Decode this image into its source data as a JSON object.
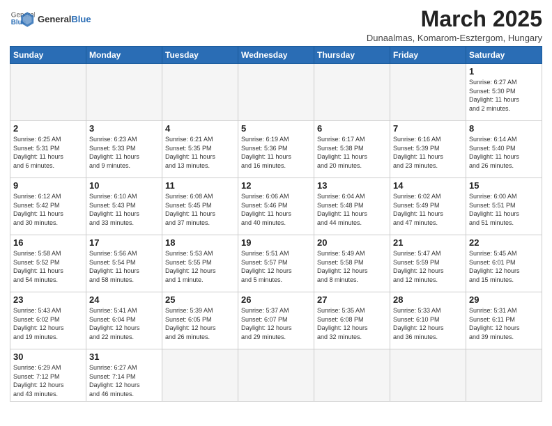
{
  "header": {
    "logo_general": "General",
    "logo_blue": "Blue",
    "month_title": "March 2025",
    "subtitle": "Dunaalmas, Komarom-Esztergom, Hungary"
  },
  "weekdays": [
    "Sunday",
    "Monday",
    "Tuesday",
    "Wednesday",
    "Thursday",
    "Friday",
    "Saturday"
  ],
  "days": [
    {
      "num": "",
      "info": "",
      "empty": true
    },
    {
      "num": "",
      "info": "",
      "empty": true
    },
    {
      "num": "",
      "info": "",
      "empty": true
    },
    {
      "num": "",
      "info": "",
      "empty": true
    },
    {
      "num": "",
      "info": "",
      "empty": true
    },
    {
      "num": "",
      "info": "",
      "empty": true
    },
    {
      "num": "1",
      "info": "Sunrise: 6:27 AM\nSunset: 5:30 PM\nDaylight: 11 hours\nand 2 minutes."
    },
    {
      "num": "2",
      "info": "Sunrise: 6:25 AM\nSunset: 5:31 PM\nDaylight: 11 hours\nand 6 minutes."
    },
    {
      "num": "3",
      "info": "Sunrise: 6:23 AM\nSunset: 5:33 PM\nDaylight: 11 hours\nand 9 minutes."
    },
    {
      "num": "4",
      "info": "Sunrise: 6:21 AM\nSunset: 5:35 PM\nDaylight: 11 hours\nand 13 minutes."
    },
    {
      "num": "5",
      "info": "Sunrise: 6:19 AM\nSunset: 5:36 PM\nDaylight: 11 hours\nand 16 minutes."
    },
    {
      "num": "6",
      "info": "Sunrise: 6:17 AM\nSunset: 5:38 PM\nDaylight: 11 hours\nand 20 minutes."
    },
    {
      "num": "7",
      "info": "Sunrise: 6:16 AM\nSunset: 5:39 PM\nDaylight: 11 hours\nand 23 minutes."
    },
    {
      "num": "8",
      "info": "Sunrise: 6:14 AM\nSunset: 5:40 PM\nDaylight: 11 hours\nand 26 minutes."
    },
    {
      "num": "9",
      "info": "Sunrise: 6:12 AM\nSunset: 5:42 PM\nDaylight: 11 hours\nand 30 minutes."
    },
    {
      "num": "10",
      "info": "Sunrise: 6:10 AM\nSunset: 5:43 PM\nDaylight: 11 hours\nand 33 minutes."
    },
    {
      "num": "11",
      "info": "Sunrise: 6:08 AM\nSunset: 5:45 PM\nDaylight: 11 hours\nand 37 minutes."
    },
    {
      "num": "12",
      "info": "Sunrise: 6:06 AM\nSunset: 5:46 PM\nDaylight: 11 hours\nand 40 minutes."
    },
    {
      "num": "13",
      "info": "Sunrise: 6:04 AM\nSunset: 5:48 PM\nDaylight: 11 hours\nand 44 minutes."
    },
    {
      "num": "14",
      "info": "Sunrise: 6:02 AM\nSunset: 5:49 PM\nDaylight: 11 hours\nand 47 minutes."
    },
    {
      "num": "15",
      "info": "Sunrise: 6:00 AM\nSunset: 5:51 PM\nDaylight: 11 hours\nand 51 minutes."
    },
    {
      "num": "16",
      "info": "Sunrise: 5:58 AM\nSunset: 5:52 PM\nDaylight: 11 hours\nand 54 minutes."
    },
    {
      "num": "17",
      "info": "Sunrise: 5:56 AM\nSunset: 5:54 PM\nDaylight: 11 hours\nand 58 minutes."
    },
    {
      "num": "18",
      "info": "Sunrise: 5:53 AM\nSunset: 5:55 PM\nDaylight: 12 hours\nand 1 minute."
    },
    {
      "num": "19",
      "info": "Sunrise: 5:51 AM\nSunset: 5:57 PM\nDaylight: 12 hours\nand 5 minutes."
    },
    {
      "num": "20",
      "info": "Sunrise: 5:49 AM\nSunset: 5:58 PM\nDaylight: 12 hours\nand 8 minutes."
    },
    {
      "num": "21",
      "info": "Sunrise: 5:47 AM\nSunset: 5:59 PM\nDaylight: 12 hours\nand 12 minutes."
    },
    {
      "num": "22",
      "info": "Sunrise: 5:45 AM\nSunset: 6:01 PM\nDaylight: 12 hours\nand 15 minutes."
    },
    {
      "num": "23",
      "info": "Sunrise: 5:43 AM\nSunset: 6:02 PM\nDaylight: 12 hours\nand 19 minutes."
    },
    {
      "num": "24",
      "info": "Sunrise: 5:41 AM\nSunset: 6:04 PM\nDaylight: 12 hours\nand 22 minutes."
    },
    {
      "num": "25",
      "info": "Sunrise: 5:39 AM\nSunset: 6:05 PM\nDaylight: 12 hours\nand 26 minutes."
    },
    {
      "num": "26",
      "info": "Sunrise: 5:37 AM\nSunset: 6:07 PM\nDaylight: 12 hours\nand 29 minutes."
    },
    {
      "num": "27",
      "info": "Sunrise: 5:35 AM\nSunset: 6:08 PM\nDaylight: 12 hours\nand 32 minutes."
    },
    {
      "num": "28",
      "info": "Sunrise: 5:33 AM\nSunset: 6:10 PM\nDaylight: 12 hours\nand 36 minutes."
    },
    {
      "num": "29",
      "info": "Sunrise: 5:31 AM\nSunset: 6:11 PM\nDaylight: 12 hours\nand 39 minutes."
    },
    {
      "num": "30",
      "info": "Sunrise: 6:29 AM\nSunset: 7:12 PM\nDaylight: 12 hours\nand 43 minutes."
    },
    {
      "num": "31",
      "info": "Sunrise: 6:27 AM\nSunset: 7:14 PM\nDaylight: 12 hours\nand 46 minutes."
    },
    {
      "num": "",
      "info": "",
      "empty": true
    },
    {
      "num": "",
      "info": "",
      "empty": true
    },
    {
      "num": "",
      "info": "",
      "empty": true
    },
    {
      "num": "",
      "info": "",
      "empty": true
    },
    {
      "num": "",
      "info": "",
      "empty": true
    }
  ]
}
